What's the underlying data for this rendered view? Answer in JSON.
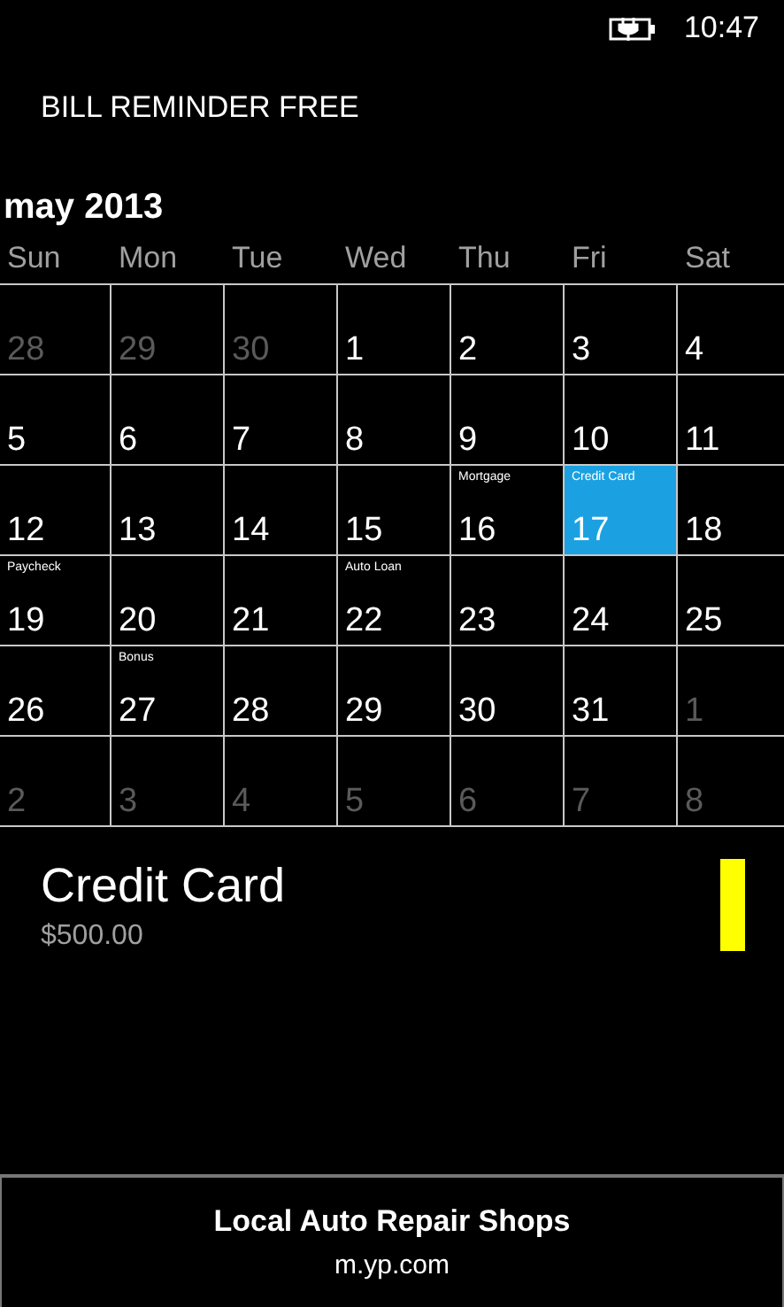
{
  "status_bar": {
    "time": "10:47"
  },
  "app_title": "BILL REMINDER FREE",
  "calendar": {
    "month": "may 2013",
    "weekdays": [
      "Sun",
      "Mon",
      "Tue",
      "Wed",
      "Thu",
      "Fri",
      "Sat"
    ],
    "weeks": [
      [
        {
          "day": "28",
          "in_month": false,
          "selected": false
        },
        {
          "day": "29",
          "in_month": false,
          "selected": false
        },
        {
          "day": "30",
          "in_month": false,
          "selected": false
        },
        {
          "day": "1",
          "in_month": true,
          "selected": false
        },
        {
          "day": "2",
          "in_month": true,
          "selected": false
        },
        {
          "day": "3",
          "in_month": true,
          "selected": false
        },
        {
          "day": "4",
          "in_month": true,
          "selected": false
        }
      ],
      [
        {
          "day": "5",
          "in_month": true,
          "selected": false
        },
        {
          "day": "6",
          "in_month": true,
          "selected": false
        },
        {
          "day": "7",
          "in_month": true,
          "selected": false
        },
        {
          "day": "8",
          "in_month": true,
          "selected": false
        },
        {
          "day": "9",
          "in_month": true,
          "selected": false
        },
        {
          "day": "10",
          "in_month": true,
          "selected": false
        },
        {
          "day": "11",
          "in_month": true,
          "selected": false
        }
      ],
      [
        {
          "day": "12",
          "in_month": true,
          "selected": false
        },
        {
          "day": "13",
          "in_month": true,
          "selected": false
        },
        {
          "day": "14",
          "in_month": true,
          "selected": false
        },
        {
          "day": "15",
          "in_month": true,
          "selected": false
        },
        {
          "day": "16",
          "in_month": true,
          "selected": false,
          "bill": "Mortgage"
        },
        {
          "day": "17",
          "in_month": true,
          "selected": true,
          "bill": "Credit Card"
        },
        {
          "day": "18",
          "in_month": true,
          "selected": false
        }
      ],
      [
        {
          "day": "19",
          "in_month": true,
          "selected": false,
          "bill": "Paycheck"
        },
        {
          "day": "20",
          "in_month": true,
          "selected": false
        },
        {
          "day": "21",
          "in_month": true,
          "selected": false
        },
        {
          "day": "22",
          "in_month": true,
          "selected": false,
          "bill": "Auto Loan"
        },
        {
          "day": "23",
          "in_month": true,
          "selected": false
        },
        {
          "day": "24",
          "in_month": true,
          "selected": false
        },
        {
          "day": "25",
          "in_month": true,
          "selected": false
        }
      ],
      [
        {
          "day": "26",
          "in_month": true,
          "selected": false
        },
        {
          "day": "27",
          "in_month": true,
          "selected": false,
          "bill": "Bonus"
        },
        {
          "day": "28",
          "in_month": true,
          "selected": false
        },
        {
          "day": "29",
          "in_month": true,
          "selected": false
        },
        {
          "day": "30",
          "in_month": true,
          "selected": false
        },
        {
          "day": "31",
          "in_month": true,
          "selected": false
        },
        {
          "day": "1",
          "in_month": false,
          "selected": false
        }
      ],
      [
        {
          "day": "2",
          "in_month": false,
          "selected": false
        },
        {
          "day": "3",
          "in_month": false,
          "selected": false
        },
        {
          "day": "4",
          "in_month": false,
          "selected": false
        },
        {
          "day": "5",
          "in_month": false,
          "selected": false
        },
        {
          "day": "6",
          "in_month": false,
          "selected": false
        },
        {
          "day": "7",
          "in_month": false,
          "selected": false
        },
        {
          "day": "8",
          "in_month": false,
          "selected": false
        }
      ]
    ]
  },
  "bills": [
    {
      "name": "Credit Card",
      "amount": "$500.00",
      "color": "#ffff00"
    }
  ],
  "ad": {
    "title": "Local Auto Repair Shops",
    "url": "m.yp.com"
  }
}
